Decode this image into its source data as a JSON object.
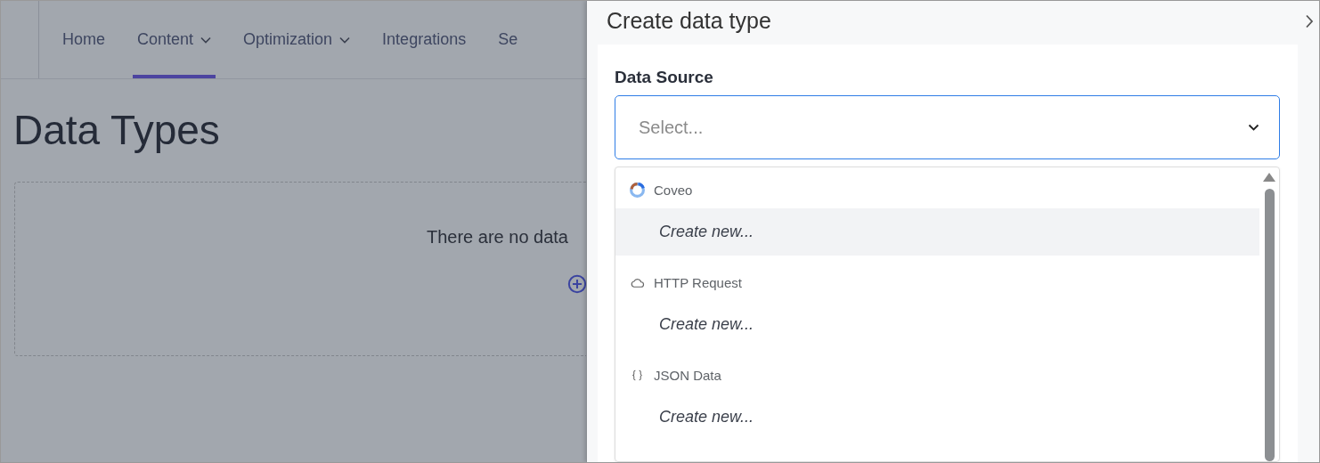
{
  "nav": {
    "tabs": [
      {
        "label": "Home",
        "selected": false,
        "has_menu": false
      },
      {
        "label": "Content",
        "selected": true,
        "has_menu": true
      },
      {
        "label": "Optimization",
        "selected": false,
        "has_menu": true
      },
      {
        "label": "Integrations",
        "selected": false,
        "has_menu": false
      },
      {
        "label": "Se",
        "selected": false,
        "has_menu": false
      }
    ]
  },
  "page": {
    "title": "Data Types",
    "empty_message": "There are no data"
  },
  "panel": {
    "title": "Create data type",
    "field": {
      "label": "Data Source",
      "placeholder": "Select..."
    },
    "groups": [
      {
        "name": "Coveo",
        "kind": "coveo",
        "options": [
          {
            "label": "Create new...",
            "highlighted": true
          }
        ]
      },
      {
        "name": "HTTP Request",
        "kind": "cloud",
        "options": [
          {
            "label": "Create new...",
            "highlighted": false
          }
        ]
      },
      {
        "name": "JSON Data",
        "kind": "braces",
        "options": [
          {
            "label": "Create new...",
            "highlighted": false
          }
        ]
      }
    ]
  }
}
